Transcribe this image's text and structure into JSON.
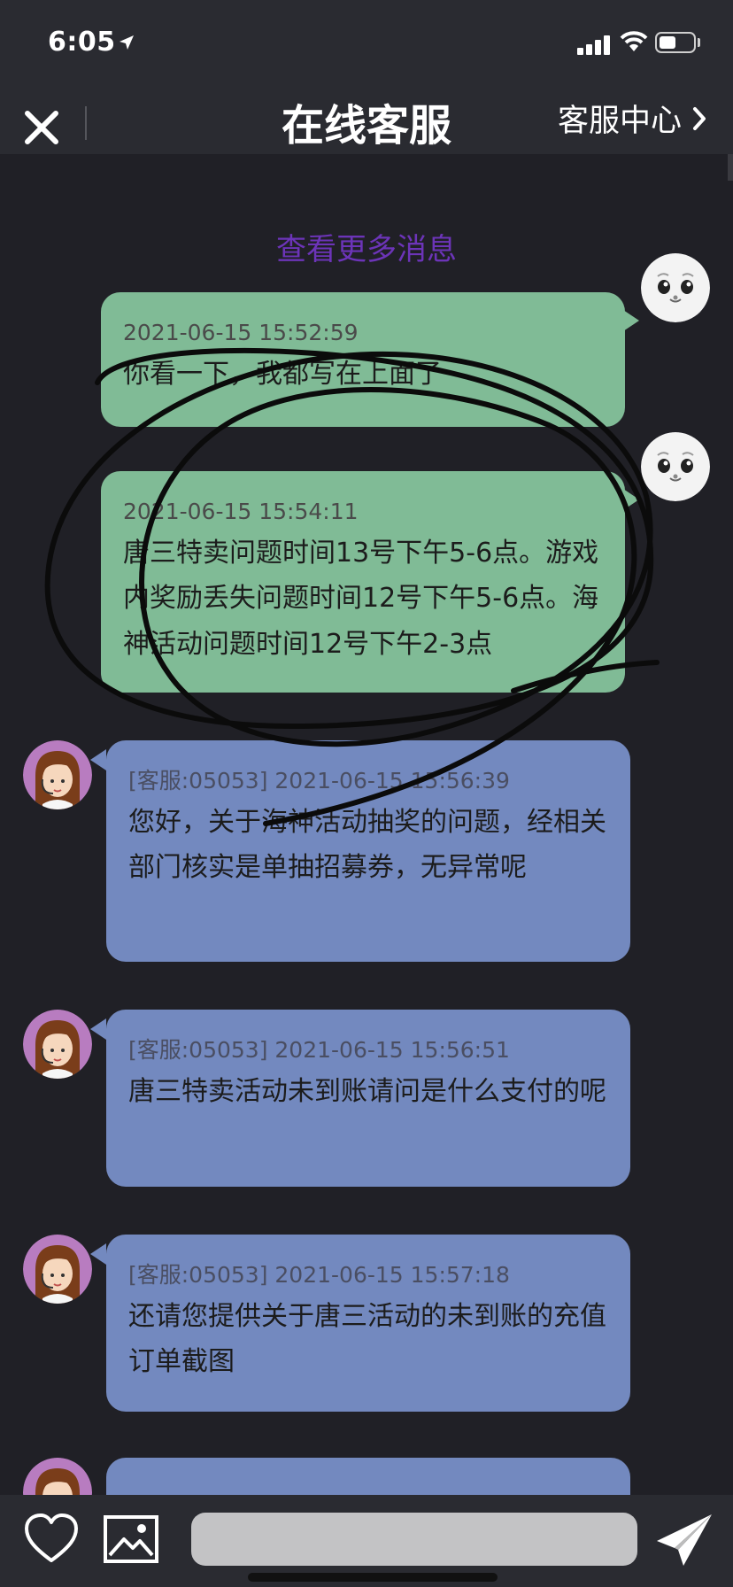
{
  "status": {
    "time": "6:05"
  },
  "header": {
    "title": "在线客服",
    "service_center": "客服中心",
    "close_icon": "close-icon",
    "chevron_icon": "chevron-right-icon"
  },
  "chat": {
    "load_more": "查看更多消息",
    "messages": [
      {
        "sender": "me",
        "timestamp": "2021-06-15 15:52:59",
        "text": "你看一下，我都写在上面了"
      },
      {
        "sender": "me",
        "timestamp": "2021-06-15 15:54:11",
        "text": "唐三特卖问题时间13号下午5-6点。游戏内奖励丢失问题时间12号下午5-6点。海神活动问题时间12号下午2-3点"
      },
      {
        "sender": "agent",
        "timestamp": "[客服:05053] 2021-06-15 15:56:39",
        "text": "您好，关于海神活动抽奖的问题，经相关部门核实是单抽招募券，无异常呢"
      },
      {
        "sender": "agent",
        "timestamp": "[客服:05053] 2021-06-15 15:56:51",
        "text": " 唐三特卖活动未到账请问是什么支付的呢"
      },
      {
        "sender": "agent",
        "timestamp": "[客服:05053] 2021-06-15 15:57:18",
        "text": "还请您提供关于唐三活动的未到账的充值订单截图"
      },
      {
        "sender": "agent",
        "timestamp": "",
        "text": ""
      }
    ]
  },
  "composer": {
    "placeholder": "",
    "value": ""
  },
  "colors": {
    "my_bubble": "#80bb96",
    "agent_bubble": "#7389bf",
    "load_more": "#6c34b8",
    "background": "#202026"
  }
}
